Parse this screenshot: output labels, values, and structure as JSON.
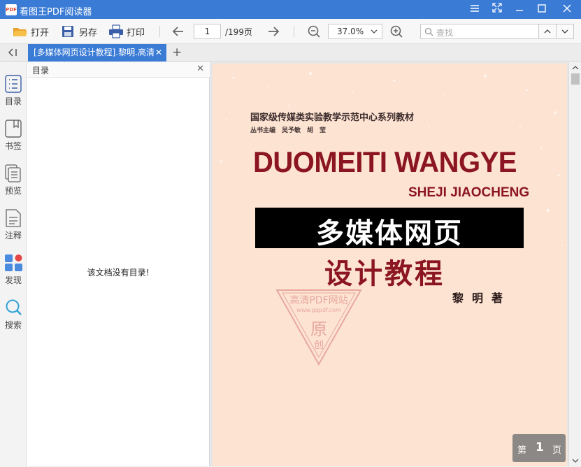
{
  "window": {
    "title": "看图王PDF阅读器",
    "logo_text": "PDF"
  },
  "toolbar": {
    "open_label": "打开",
    "saveas_label": "另存",
    "print_label": "打印",
    "current_page": "1",
    "total_pages": "/199页",
    "zoom": "37.0%",
    "search_placeholder": "查找"
  },
  "tabs": [
    {
      "label": "[多媒体网页设计教程].黎明.高清"
    }
  ],
  "sidebar": {
    "items": [
      {
        "label": "目录",
        "icon": "toc-icon"
      },
      {
        "label": "书签",
        "icon": "bookmark-icon"
      },
      {
        "label": "预览",
        "icon": "preview-icon"
      },
      {
        "label": "注释",
        "icon": "annotation-icon"
      },
      {
        "label": "发现",
        "icon": "discover-icon"
      },
      {
        "label": "搜索",
        "icon": "search-icon"
      }
    ]
  },
  "panel": {
    "title": "目录",
    "empty_message": "该文档没有目录!"
  },
  "document": {
    "series": "国家级传媒类实验教学示范中心系列教材",
    "editors": "丛书主编　吴予敏　胡　莹",
    "title_pinyin": "DUOMEITI WANGYE",
    "subtitle_pinyin": "SHEJI JIAOCHENG",
    "title_cn_line1": "多媒体网页",
    "title_cn_line2": "设计教程",
    "author": "黎明著",
    "watermark_text": "高清PDF网站",
    "watermark_url": "www.gqpdf.com",
    "watermark_char1": "原",
    "watermark_char2": "创"
  },
  "page_indicator": {
    "prefix": "第",
    "number": "1",
    "suffix": "页"
  },
  "colors": {
    "accent": "#3a7bd5",
    "cover_bg": "#fde3d2",
    "title_red": "#8b1520"
  }
}
